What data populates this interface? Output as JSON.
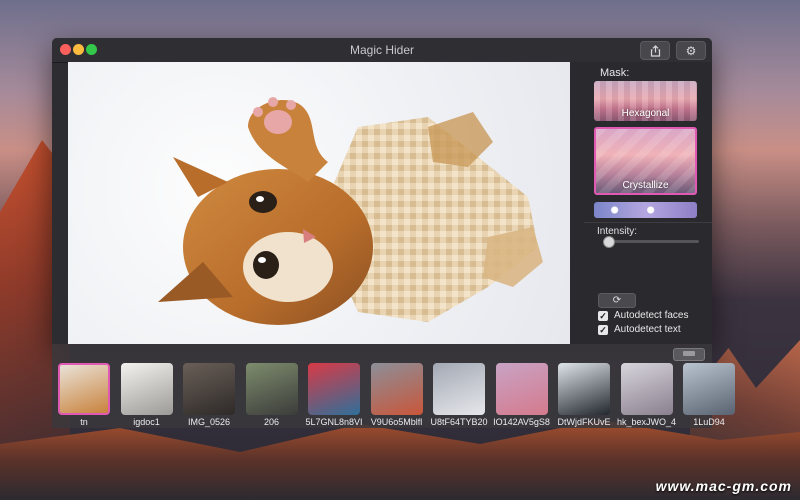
{
  "window": {
    "title": "Magic Hider"
  },
  "toolbar": {
    "share_icon": "share-icon",
    "settings_icon": "gear-icon"
  },
  "panel": {
    "mask_label": "Mask:",
    "masks": [
      {
        "name": "Hexagonal",
        "selected": false
      },
      {
        "name": "Crystallize",
        "selected": true
      },
      {
        "name": "",
        "selected": false
      }
    ],
    "intensity_label": "Intensity:",
    "intensity_value": 0.05,
    "refresh_icon": "refresh-icon",
    "autodetect_faces": {
      "label": "Autodetect faces",
      "checked": true
    },
    "autodetect_text": {
      "label": "Autodetect text",
      "checked": true
    }
  },
  "thumbnails": [
    {
      "label": "tn",
      "selected": true,
      "colors": [
        "#e9e2d8",
        "#c9823c"
      ]
    },
    {
      "label": "igdoc1",
      "selected": false,
      "colors": [
        "#f4f2ee",
        "#9c9a96"
      ]
    },
    {
      "label": "IMG_0526",
      "selected": false,
      "colors": [
        "#6a5f58",
        "#2e2a28"
      ]
    },
    {
      "label": "206",
      "selected": false,
      "colors": [
        "#7e8c6d",
        "#3b3c3a"
      ]
    },
    {
      "label": "5L7GNL8n8VI",
      "selected": false,
      "colors": [
        "#d93a46",
        "#2f6f9a"
      ]
    },
    {
      "label": "V9U6o5Mblfl",
      "selected": false,
      "colors": [
        "#8c8f99",
        "#c9563a"
      ]
    },
    {
      "label": "U8tF64TYB20",
      "selected": false,
      "colors": [
        "#a3a9b4",
        "#e6e7eb"
      ]
    },
    {
      "label": "IO142AV5gS8",
      "selected": false,
      "colors": [
        "#c9a3c4",
        "#d47a8d"
      ]
    },
    {
      "label": "DtWjdFKUvE",
      "selected": false,
      "colors": [
        "#dfe4ea",
        "#23272e"
      ]
    },
    {
      "label": "hk_bexJWO_4",
      "selected": false,
      "colors": [
        "#d7d5dc",
        "#8a7f8e"
      ]
    },
    {
      "label": "1LuD94",
      "selected": false,
      "colors": [
        "#b9c4cf",
        "#596270"
      ]
    }
  ],
  "watermark": "www.mac-gm.com"
}
